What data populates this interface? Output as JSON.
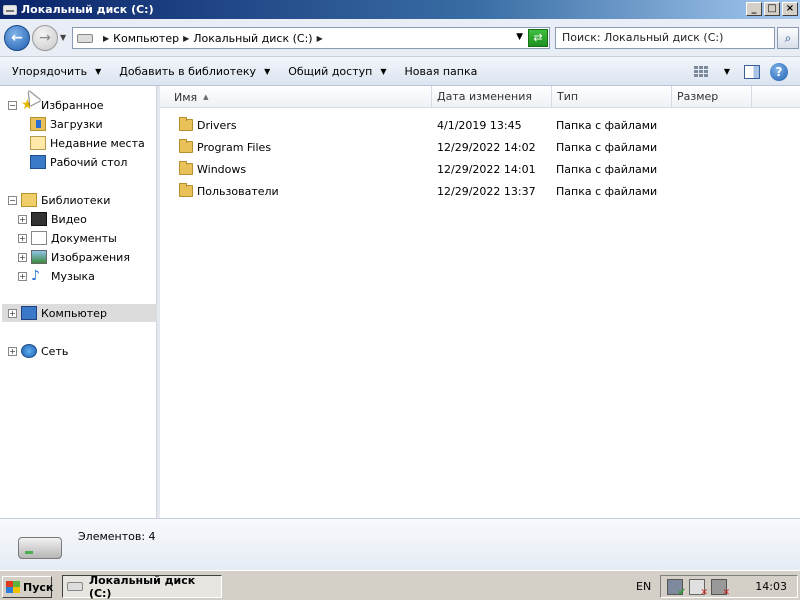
{
  "window": {
    "title": "Локальный диск (C:)",
    "controls": {
      "minimize": "_",
      "maximize": "□",
      "close": "×"
    }
  },
  "address": {
    "crumbs": [
      "Компьютер",
      "Локальный диск (C:)"
    ],
    "search_placeholder": "Поиск: Локальный диск (C:)"
  },
  "toolbar": {
    "organize": "Упорядочить",
    "add_to_library": "Добавить в библиотеку",
    "share": "Общий доступ",
    "new_folder": "Новая папка"
  },
  "nav": {
    "favorites": {
      "label": "Избранное",
      "items": [
        "Загрузки",
        "Недавние места",
        "Рабочий стол"
      ]
    },
    "libraries": {
      "label": "Библиотеки",
      "items": [
        "Видео",
        "Документы",
        "Изображения",
        "Музыка"
      ]
    },
    "computer": "Компьютер",
    "network": "Сеть"
  },
  "columns": {
    "name": "Имя",
    "date": "Дата изменения",
    "type": "Тип",
    "size": "Размер"
  },
  "files": [
    {
      "name": "Drivers",
      "date": "4/1/2019 13:45",
      "type": "Папка с файлами",
      "size": ""
    },
    {
      "name": "Program Files",
      "date": "12/29/2022 14:02",
      "type": "Папка с файлами",
      "size": ""
    },
    {
      "name": "Windows",
      "date": "12/29/2022 14:01",
      "type": "Папка с файлами",
      "size": ""
    },
    {
      "name": "Пользователи",
      "date": "12/29/2022 13:37",
      "type": "Папка с файлами",
      "size": ""
    }
  ],
  "details": {
    "item_count": "Элементов: 4"
  },
  "taskbar": {
    "start": "Пуск",
    "task_title": "Локальный диск (C:)",
    "language": "EN",
    "clock": "14:03"
  }
}
